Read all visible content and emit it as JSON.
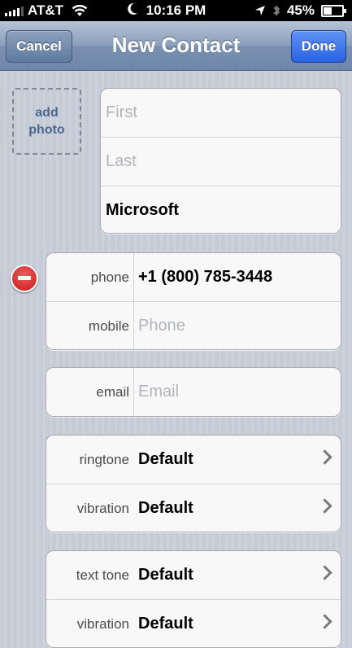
{
  "status_bar": {
    "carrier": "AT&T",
    "time": "10:16 PM",
    "battery": "45%"
  },
  "nav": {
    "title": "New Contact",
    "cancel_label": "Cancel",
    "done_label": "Done"
  },
  "add_photo": {
    "line1": "add",
    "line2": "photo"
  },
  "name_fields": {
    "first_placeholder": "First",
    "last_placeholder": "Last",
    "company_value": "Microsoft"
  },
  "phone_fields": [
    {
      "label": "phone",
      "value": "+1 (800) 785-3448"
    },
    {
      "label": "mobile",
      "placeholder": "Phone"
    }
  ],
  "email_field": {
    "label": "email",
    "placeholder": "Email"
  },
  "tone_group_1": [
    {
      "label": "ringtone",
      "value": "Default"
    },
    {
      "label": "vibration",
      "value": "Default"
    }
  ],
  "tone_group_2": [
    {
      "label": "text tone",
      "value": "Default"
    },
    {
      "label": "vibration",
      "value": "Default"
    }
  ]
}
